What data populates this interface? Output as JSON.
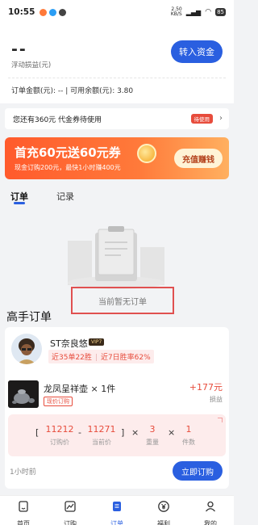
{
  "status_bar": {
    "time": "10:55",
    "speed_top": "2.50",
    "speed_bottom": "KB/S",
    "network": "4G",
    "battery": "85"
  },
  "header": {
    "float_value": "--",
    "float_label": "浮动损益(元)",
    "transfer_button": "转入资金",
    "balance_row": "订单金额(元): -- | 可用余额(元): 3.80"
  },
  "coupon": {
    "text": "您还有360元 代金券待使用",
    "tag": "待使用"
  },
  "banner": {
    "title": "首充60元送60元券",
    "subtitle": "现金订购200元，最快1小时赚400元",
    "button": "充值赚钱"
  },
  "tabs": [
    {
      "label": "订单"
    },
    {
      "label": "记录"
    }
  ],
  "empty": {
    "text": "当前暂无订单"
  },
  "experts": {
    "title": "高手订单",
    "trader": {
      "name": "ST奈良悠",
      "vip": "VIP7",
      "record": "近35单22胜",
      "win_rate": "近7日胜率62%"
    },
    "product": {
      "name": "龙凤呈祥壶 × 1件",
      "tag": "现价订购",
      "pnl_value": "+177元",
      "pnl_label": "损益"
    },
    "calc": {
      "open_bracket": "[",
      "close_bracket": "]",
      "order_price": "11212",
      "order_price_label": "订购价",
      "minus": "-",
      "current_price": "11271",
      "current_price_label": "当前价",
      "times1": "×",
      "weight": "3",
      "weight_label": "重量",
      "times2": "×",
      "qty": "1",
      "qty_label": "件数"
    },
    "time": "1小时前",
    "buy_button": "立即订购"
  },
  "nav": [
    {
      "label": "首页",
      "icon": "home-icon"
    },
    {
      "label": "订购",
      "icon": "chart-icon"
    },
    {
      "label": "订单",
      "icon": "order-icon"
    },
    {
      "label": "福利",
      "icon": "yen-icon"
    },
    {
      "label": "我的",
      "icon": "user-icon"
    }
  ],
  "colors": {
    "accent": "#2a5fe0",
    "profit": "#e74c3c",
    "banner": "#ff5a2c"
  }
}
